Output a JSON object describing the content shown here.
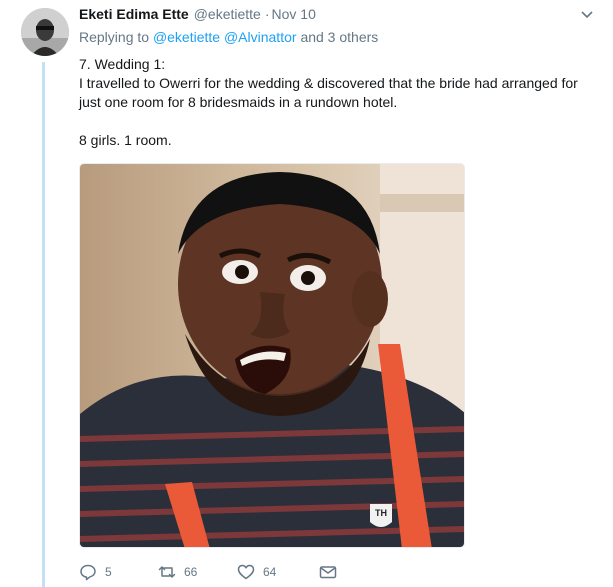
{
  "tweet": {
    "author_name": "Eketi Edima Ette",
    "author_handle": "@eketiette",
    "separator": "·",
    "timestamp": "Nov 10",
    "reply_prefix": "Replying to",
    "reply_user_1": "@eketiette",
    "reply_user_2": "@Alvinattor",
    "reply_suffix": "and 3 others",
    "text": "7. Wedding 1:\nI travelled to Owerri for the wedding & discovered that the bride had arranged for just one room for 8 bridesmaids in a rundown hotel.\n\n8 girls. 1 room.",
    "media_icon": "photo-reaction-image",
    "shirt_logo_text": "TH"
  },
  "actions": {
    "reply_count": "5",
    "retweet_count": "66",
    "like_count": "64"
  },
  "icons": {
    "caret": "chevron-down-icon",
    "reply": "reply-icon",
    "retweet": "retweet-icon",
    "like": "heart-icon",
    "dm": "envelope-icon"
  },
  "colors": {
    "link": "#1da1f2",
    "muted": "#657786",
    "thread_line": "#c4e0f3"
  }
}
